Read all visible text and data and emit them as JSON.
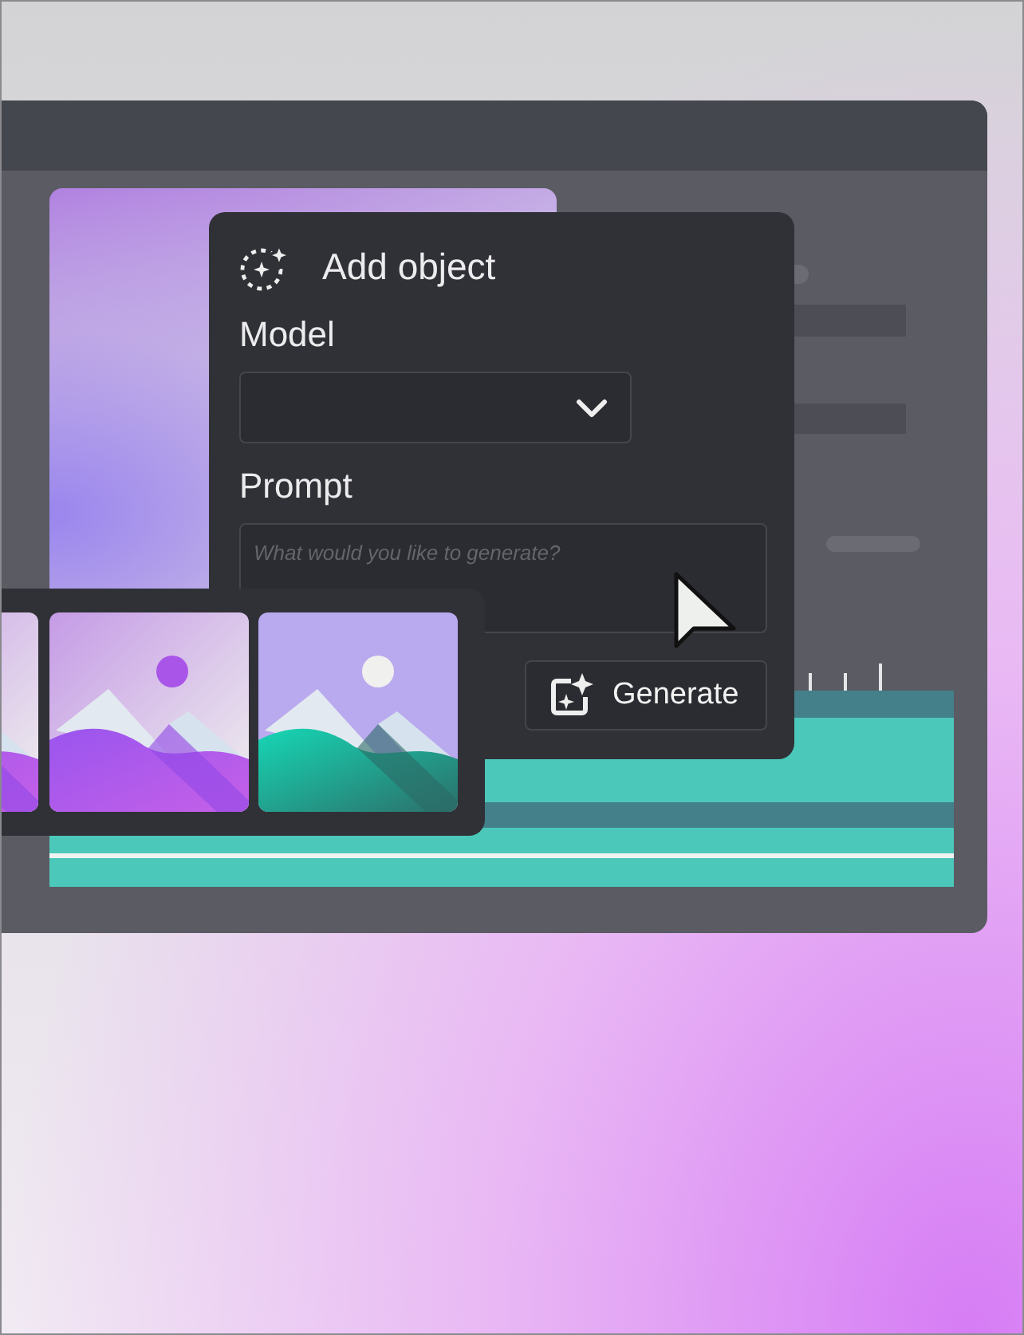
{
  "dialog": {
    "title": "Add object",
    "model": {
      "label": "Model"
    },
    "prompt": {
      "label": "Prompt",
      "placeholder": "What would you like to generate?"
    },
    "button": "Generate"
  }
}
